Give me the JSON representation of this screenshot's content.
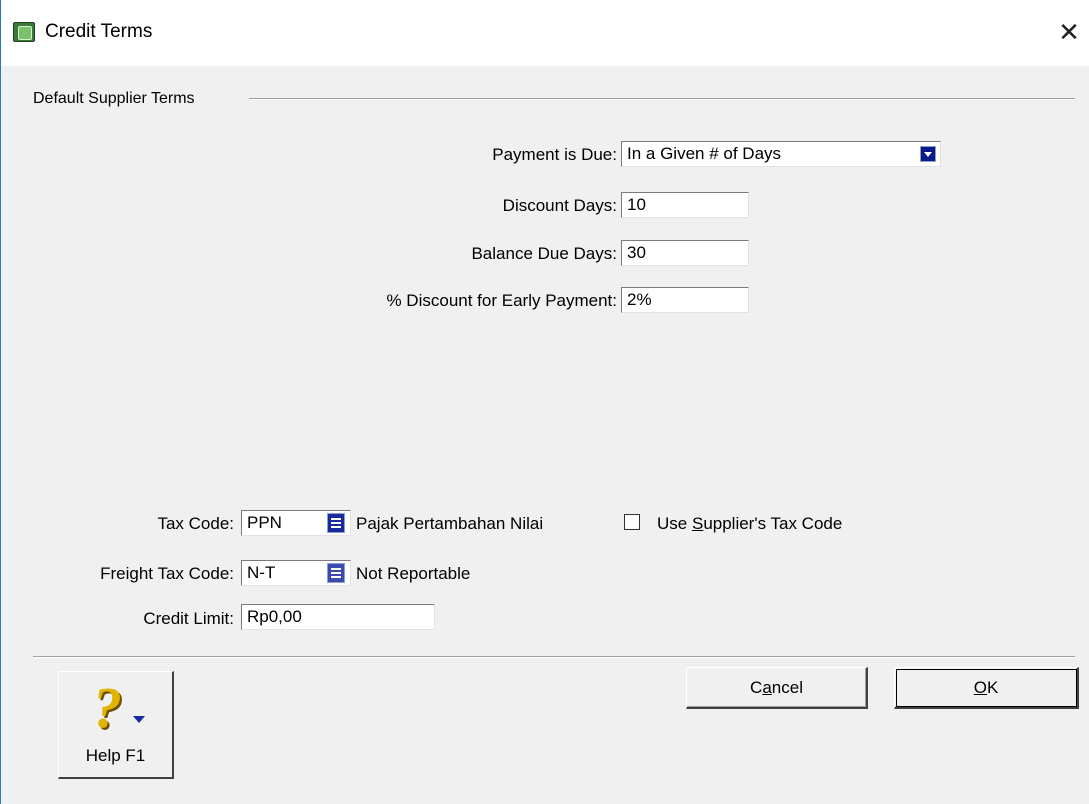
{
  "window": {
    "title": "Credit Terms",
    "close_glyph": "✕"
  },
  "group": {
    "label": "Default Supplier Terms"
  },
  "payment_due": {
    "label": "Payment is Due:",
    "value": "In a Given # of Days"
  },
  "discount_days": {
    "label": "Discount Days:",
    "value": "10"
  },
  "balance_due_days": {
    "label": "Balance Due Days:",
    "value": "30"
  },
  "early_discount": {
    "label": "% Discount for Early Payment:",
    "value": "2%"
  },
  "tax_code": {
    "label": "Tax Code:",
    "value": "PPN",
    "description": "Pajak Pertambahan Nilai",
    "icon": "list-lookup-icon"
  },
  "use_supplier_tax": {
    "label_pre": "Use ",
    "label_underlined": "S",
    "label_post": "upplier's Tax Code",
    "checked": false
  },
  "freight_tax_code": {
    "label": "Freight Tax Code:",
    "value": "N-T",
    "description": "Not Reportable",
    "icon": "list-lookup-icon"
  },
  "credit_limit": {
    "label": "Credit Limit:",
    "value": "Rp0,00"
  },
  "buttons": {
    "cancel_pre": "C",
    "cancel_underlined": "a",
    "cancel_post": "ncel",
    "ok_underlined": "O",
    "ok_post": "K",
    "help_label": "Help F1",
    "help_icon": "question-mark-icon"
  },
  "colors": {
    "dialog_bg": "#f0f0f0",
    "accent_border": "#2b78c5",
    "combo_arrow": "#0a1a8c",
    "help_icon": "#e0b400"
  }
}
